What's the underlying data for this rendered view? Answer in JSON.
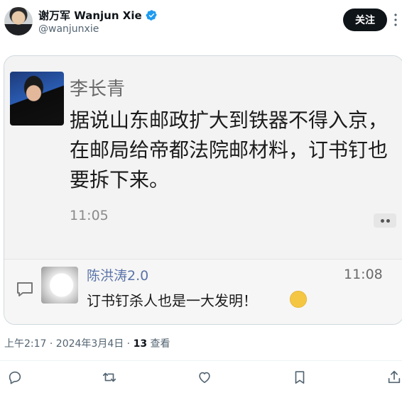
{
  "author": {
    "display_name": "谢万军 Wanjun Xie",
    "handle": "@wanjunxie"
  },
  "follow_label": "关注",
  "screenshot": {
    "poster_name": "李长青",
    "post_text": "据说山东邮政扩大到铁器不得入京，在邮局给帝都法院邮材料，订书钉也要拆下来。",
    "post_time": "11:05",
    "comment": {
      "commenter_name": "陈洪涛2.0",
      "time": "11:08",
      "text": "订书钉杀人也是一大发明！"
    }
  },
  "meta": {
    "timestamp": "上午2:17 · 2024年3月4日 · ",
    "views_count": "13",
    "views_label": " 查看"
  },
  "actions": [
    "reply-icon",
    "retweet-icon",
    "like-icon",
    "bookmark-icon",
    "share-icon"
  ],
  "colors": {
    "verified": "#1d9bf0",
    "follow_bg": "#0f1419",
    "muted": "#536471"
  }
}
